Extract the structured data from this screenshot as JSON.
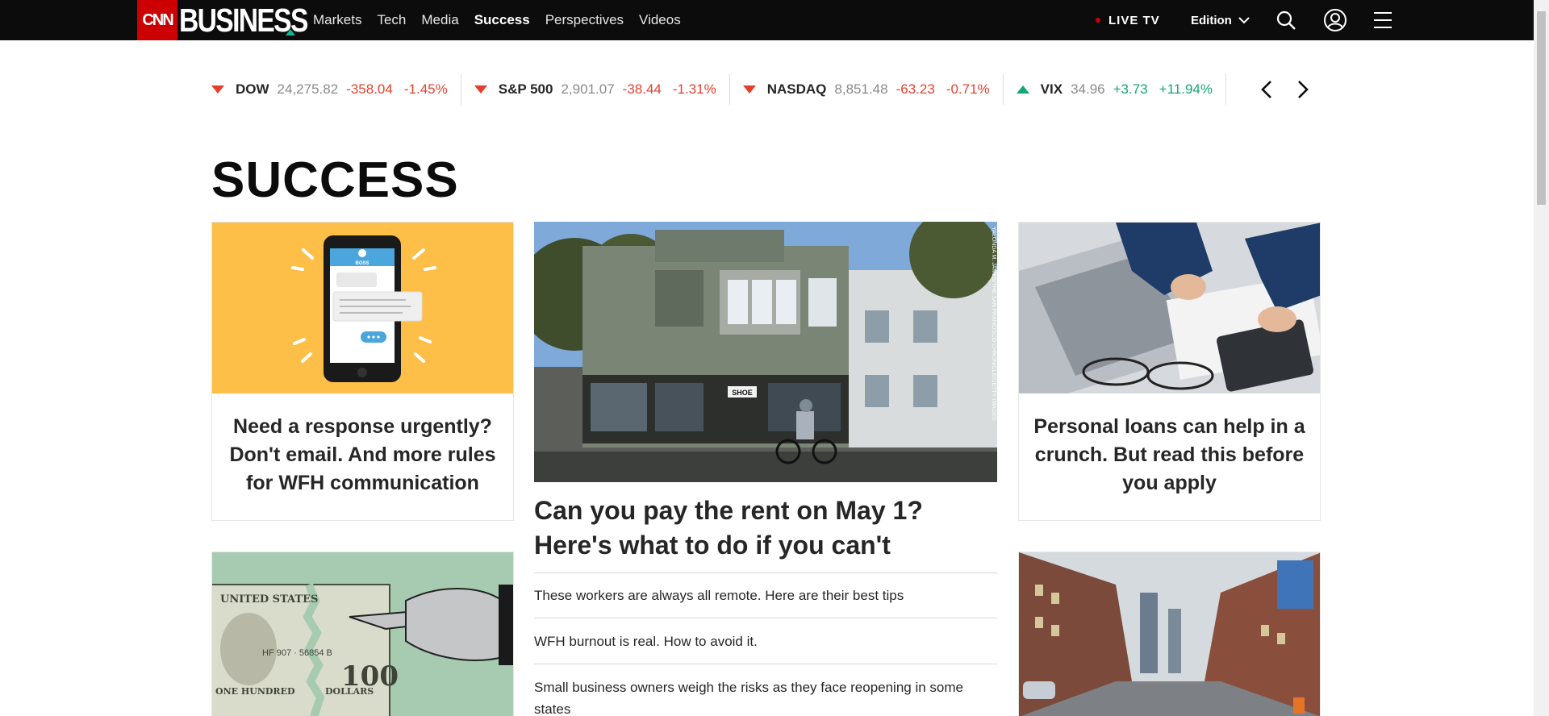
{
  "nav": {
    "logo_cnn": "CNN",
    "logo_business": "BUSINESS",
    "links": [
      "Markets",
      "Tech",
      "Media",
      "Success",
      "Perspectives",
      "Videos"
    ],
    "active": "Success",
    "live_tv": "LIVE TV",
    "edition": "Edition",
    "icons": [
      "search-icon",
      "account-icon",
      "hamburger-menu-icon"
    ]
  },
  "ticker": [
    {
      "name": "DOW",
      "value": "24,275.82",
      "change": "-358.04",
      "pct": "-1.45%",
      "dir": "down"
    },
    {
      "name": "S&P 500",
      "value": "2,901.07",
      "change": "-38.44",
      "pct": "-1.31%",
      "dir": "down"
    },
    {
      "name": "NASDAQ",
      "value": "8,851.48",
      "change": "-63.23",
      "pct": "-0.71%",
      "dir": "down"
    },
    {
      "name": "VIX",
      "value": "34.96",
      "change": "+3.73",
      "pct": "+11.94%",
      "dir": "up"
    }
  ],
  "section_title": "SUCCESS",
  "cards": {
    "left_top": "Need a response urgently? Don't email. And more rules for WFH communication",
    "right_top": "Personal loans can help in a crunch. But read this before you apply"
  },
  "main_story": {
    "headline": "Can you pay the rent on May 1? Here's what to do if you can't",
    "photo_credit": "YALONDA M. JAMES/THE SAN FRANCISCO CHRONICLE/GETTY IMAGES",
    "shop_sign": "SHOE"
  },
  "related": [
    "These workers are always all remote. Here are their best tips",
    "WFH burnout is real. How to avoid it.",
    "Small business owners weigh the risks as they face reopening in some states"
  ],
  "illustrations": {
    "phone_label": "BOSS",
    "bill_top": "UNITED STATES",
    "bill_serial": "HF 907 · 56854 B",
    "bill_denom": "100",
    "bill_bottom_left": "ONE HUNDRED",
    "bill_bottom_right": "DOLLARS"
  },
  "colors": {
    "nav_bg": "#0c0c0c",
    "cnn_red": "#cc0000",
    "negative": "#e5412e",
    "positive": "#13a673",
    "card_yellow": "#fdbf47",
    "money_green": "#a6cbb1"
  }
}
